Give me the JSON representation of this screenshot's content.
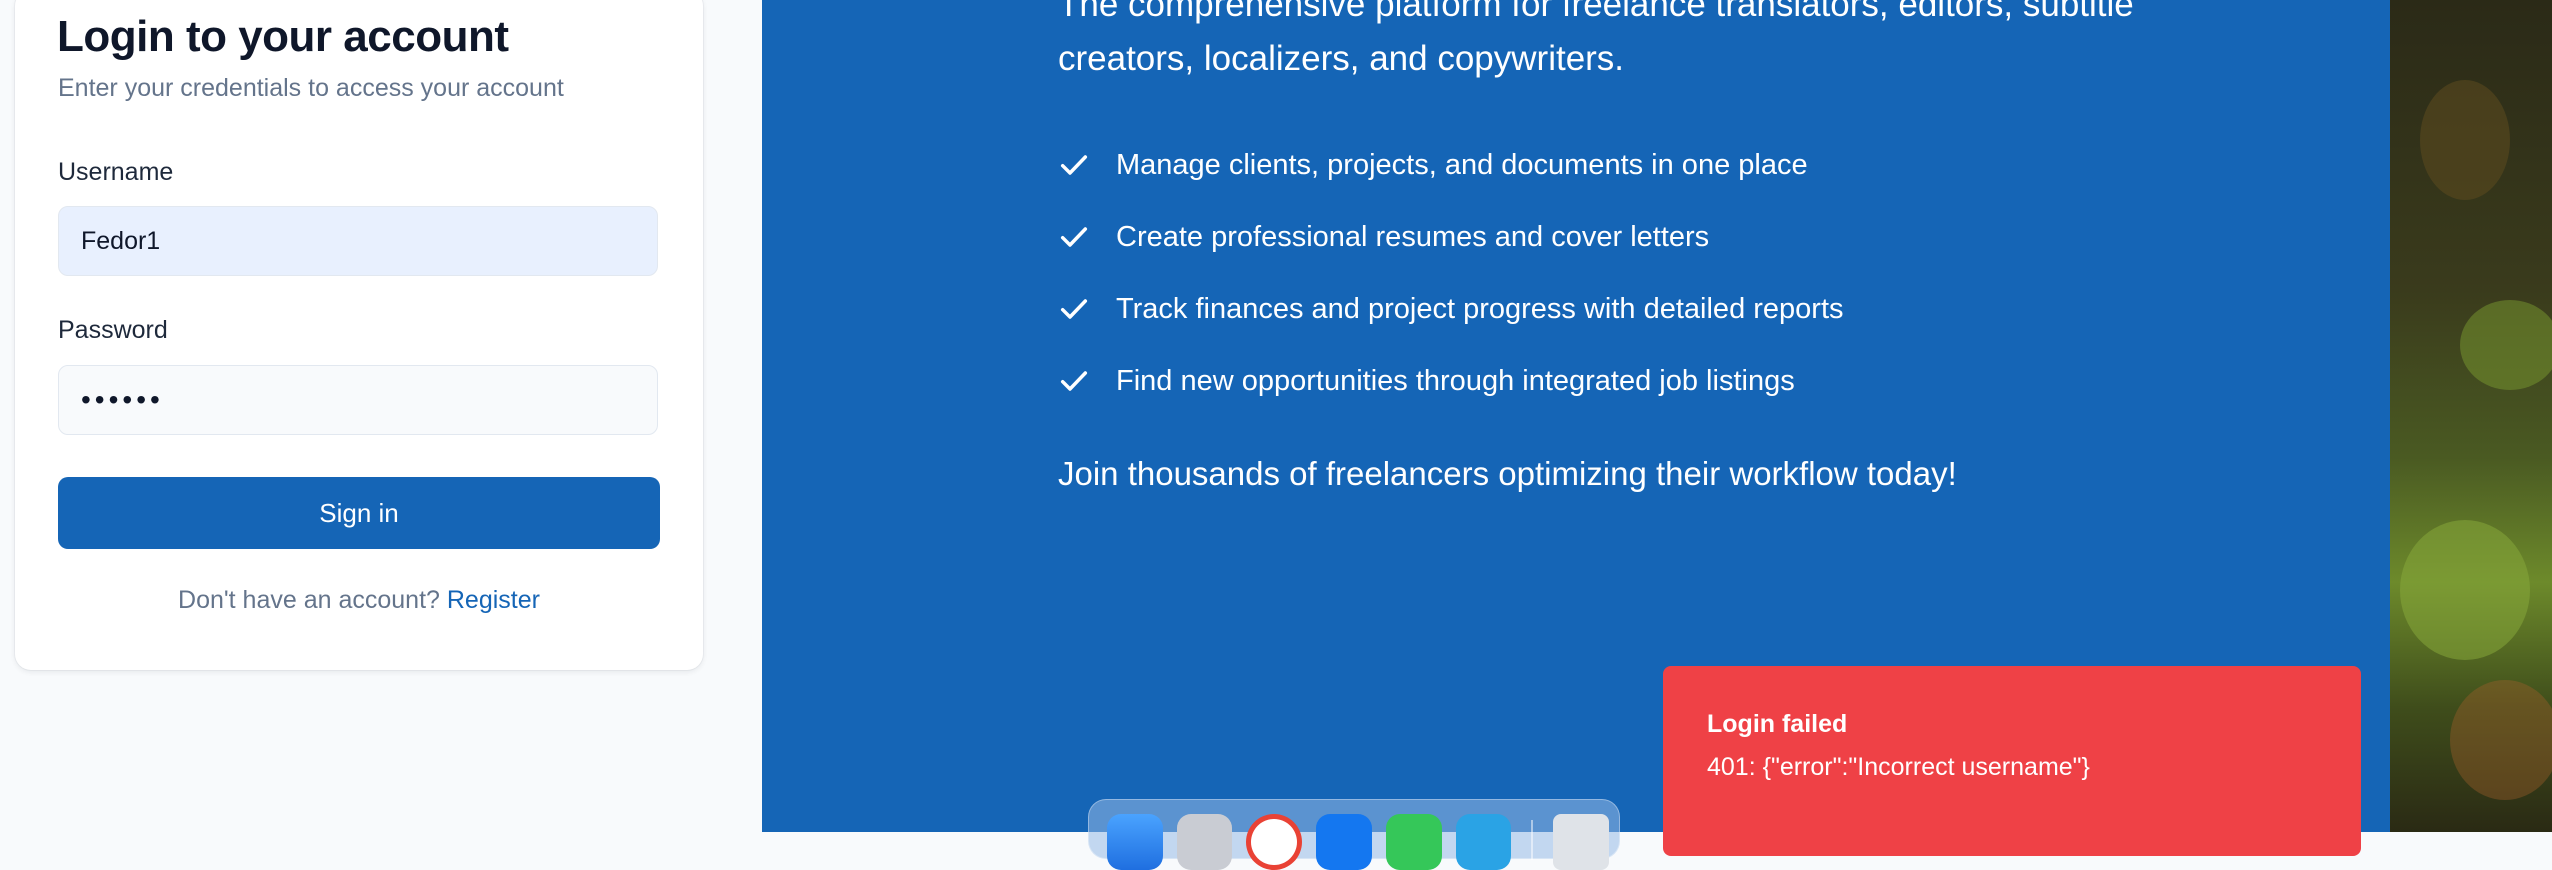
{
  "login": {
    "title": "Login to your account",
    "subtitle": "Enter your credentials to access your account",
    "username_label": "Username",
    "username_value": "Fedor1",
    "password_label": "Password",
    "password_value": "••••••",
    "sign_in_label": "Sign in",
    "register_prompt": "Don't have an account?",
    "register_link": "Register"
  },
  "promo": {
    "tagline": "The comprehensive platform for freelance translators, editors, subtitle creators, localizers, and copywriters.",
    "features": [
      "Manage clients, projects, and documents in one place",
      "Create professional resumes and cover letters",
      "Track finances and project progress with detailed reports",
      "Find new opportunities through integrated job listings"
    ],
    "feature_icon": "check-icon",
    "cta": "Join thousands of freelancers optimizing their workflow today!"
  },
  "toast": {
    "title": "Login failed",
    "message": "401: {\"error\":\"Incorrect username\"}"
  },
  "dock": {
    "apps": [
      "finder-icon",
      "launchpad-icon",
      "chrome-icon",
      "xcode-icon",
      "whatsapp-icon",
      "telegram-icon",
      "trash-icon"
    ]
  },
  "colors": {
    "brand_blue": "#1565b6",
    "toast_red": "#ef4146",
    "link_blue": "#1565b6"
  }
}
